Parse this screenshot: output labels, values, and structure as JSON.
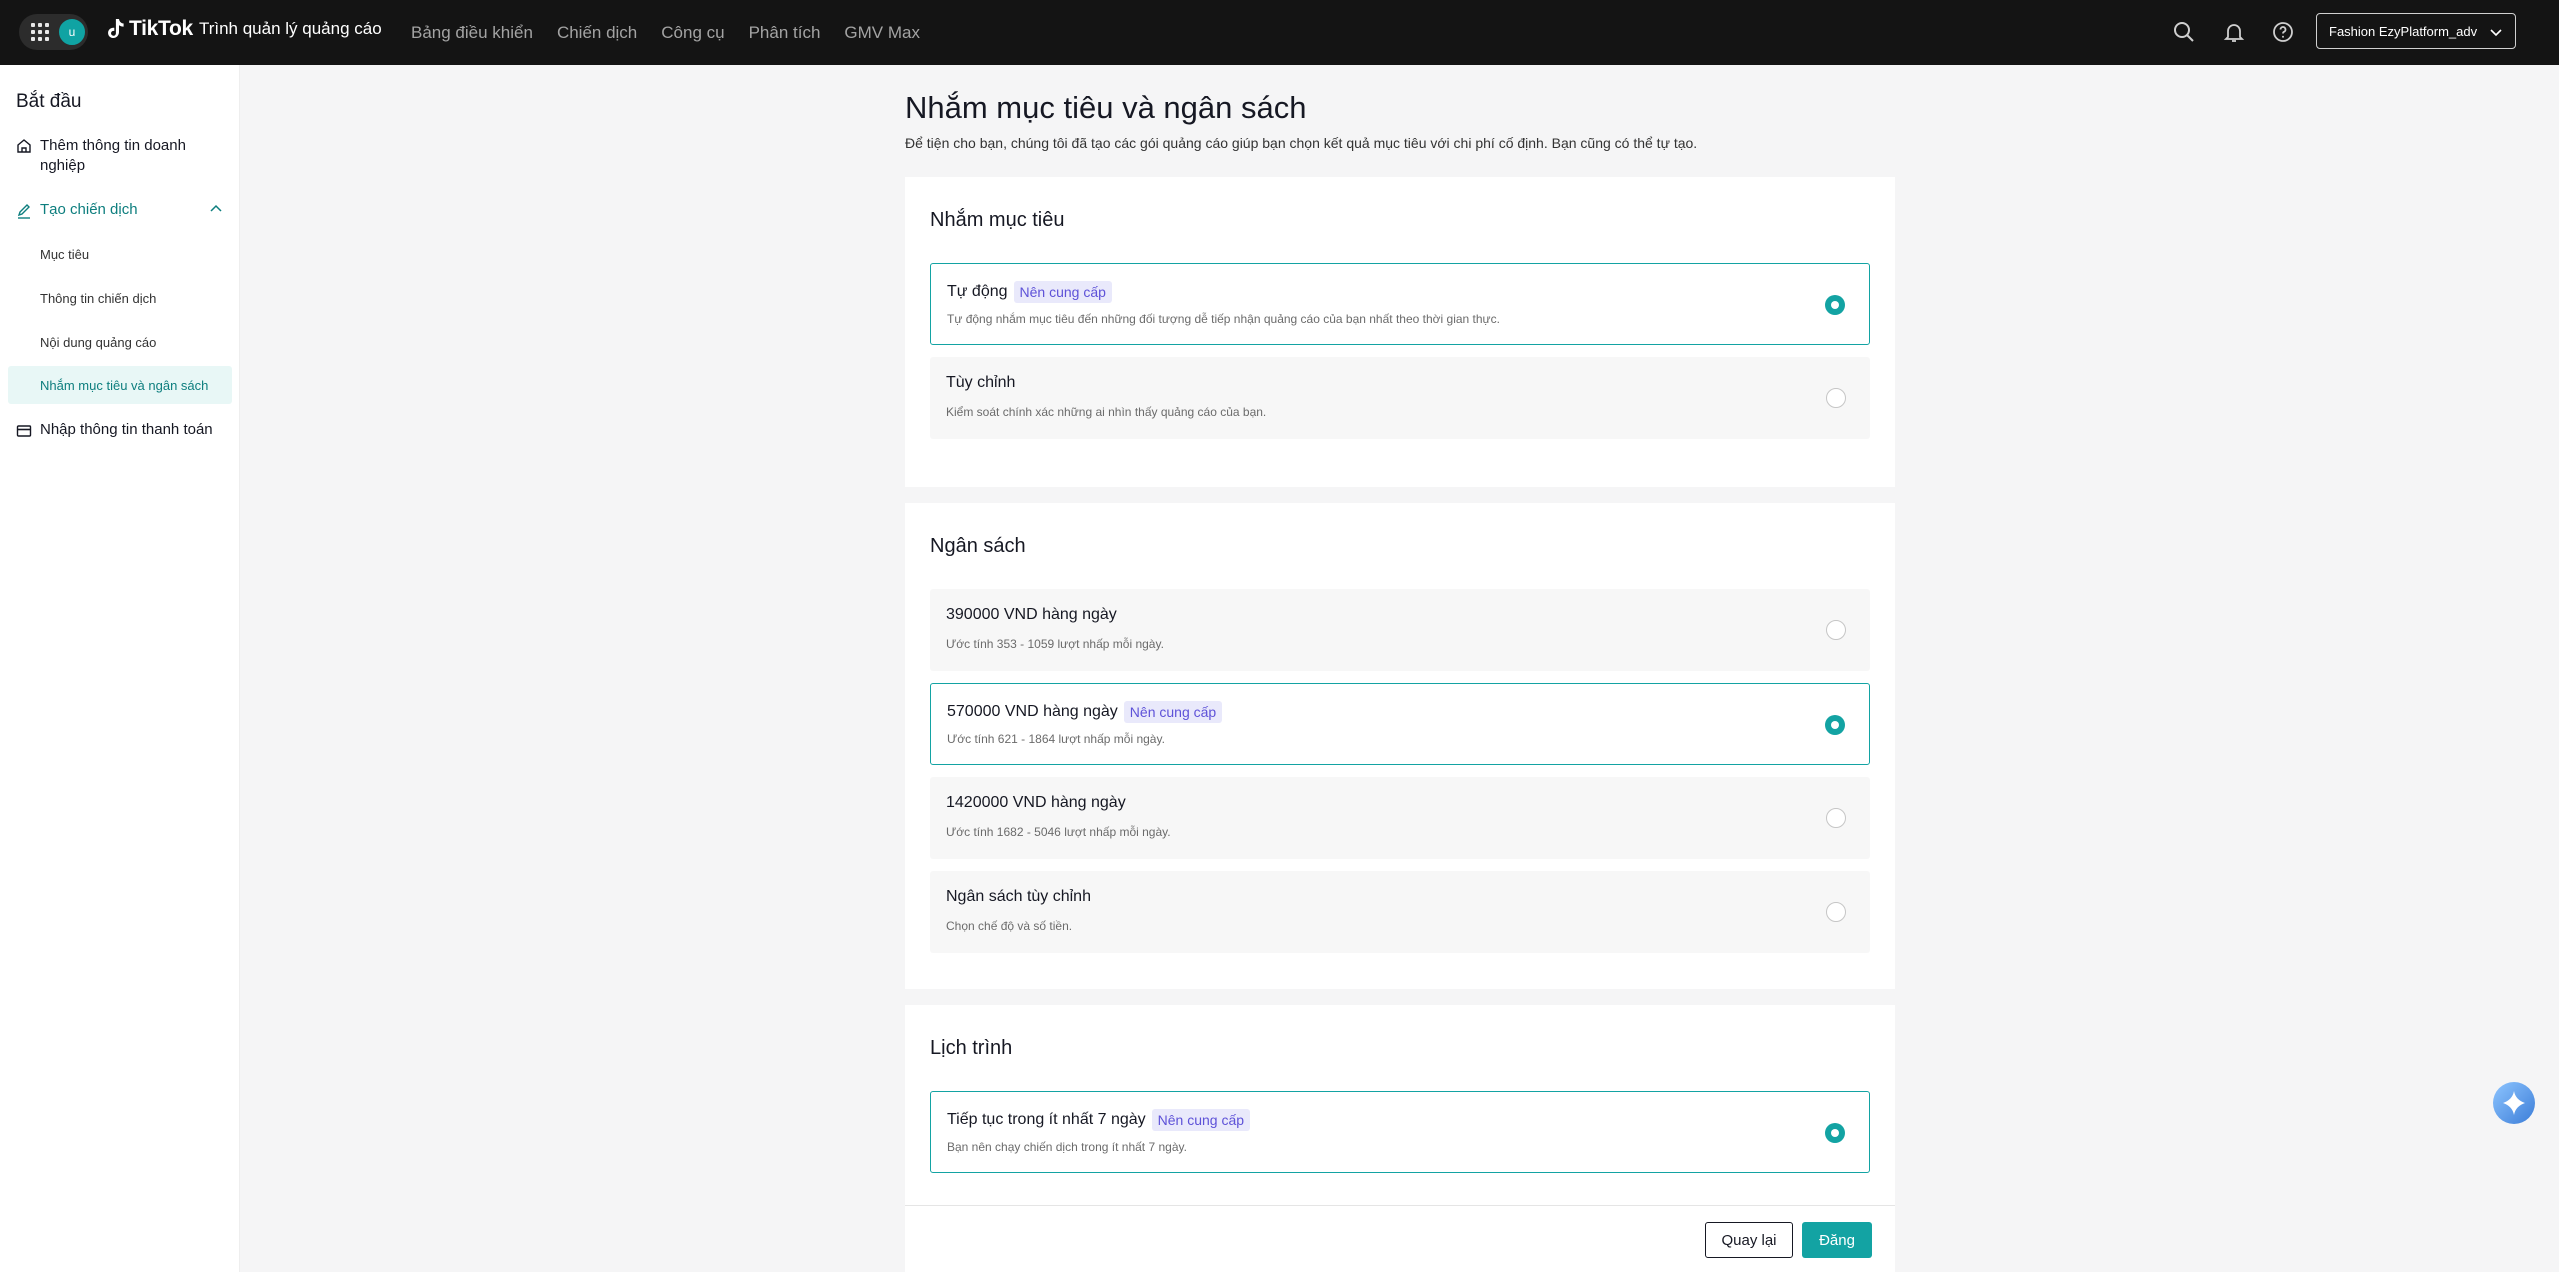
{
  "topbar": {
    "avatar_initial": "u",
    "logo_word": "TikTok",
    "logo_sub": "Trình quản lý quảng cáo",
    "nav": [
      "Bảng điều khiển",
      "Chiến dịch",
      "Công cụ",
      "Phân tích",
      "GMV Max"
    ],
    "account_name": "Fashion EzyPlatform_adv",
    "icons": [
      "search-icon",
      "bell-icon",
      "help-icon"
    ]
  },
  "sidebar": {
    "title": "Bắt đầu",
    "business_info": "Thêm thông tin doanh nghiệp",
    "create_campaign": "Tạo chiến dịch",
    "sub_items": [
      "Mục tiêu",
      "Thông tin chiến dịch",
      "Nội dung quảng cáo",
      "Nhắm mục tiêu và ngân sách"
    ],
    "payment": "Nhập thông tin thanh toán"
  },
  "page": {
    "title": "Nhắm mục tiêu và ngân sách",
    "description": "Để tiện cho bạn, chúng tôi đã tạo các gói quảng cáo giúp bạn chọn kết quả mục tiêu với chi phí cố định. Bạn cũng có thể tự tạo."
  },
  "targeting": {
    "title": "Nhắm mục tiêu",
    "options": [
      {
        "label": "Tự động",
        "badge": "Nên cung cấp",
        "desc": "Tự động nhắm mục tiêu đến những đối tượng dễ tiếp nhận quảng cáo của bạn nhất theo thời gian thực.",
        "selected": true
      },
      {
        "label": "Tùy chỉnh",
        "badge": "",
        "desc": "Kiểm soát chính xác những ai nhìn thấy quảng cáo của bạn.",
        "selected": false
      }
    ]
  },
  "budget": {
    "title": "Ngân sách",
    "options": [
      {
        "label": "390000 VND hàng ngày",
        "badge": "",
        "desc": "Ước tính 353 - 1059 lượt nhấp mỗi ngày.",
        "selected": false
      },
      {
        "label": "570000 VND hàng ngày",
        "badge": "Nên cung cấp",
        "desc": "Ước tính 621 - 1864 lượt nhấp mỗi ngày.",
        "selected": true
      },
      {
        "label": "1420000 VND hàng ngày",
        "badge": "",
        "desc": "Ước tính 1682 - 5046 lượt nhấp mỗi ngày.",
        "selected": false
      },
      {
        "label": "Ngân sách tùy chỉnh",
        "badge": "",
        "desc": "Chọn chế độ và số tiền.",
        "selected": false
      }
    ]
  },
  "schedule": {
    "title": "Lịch trình",
    "options": [
      {
        "label": "Tiếp tục trong ít nhất 7 ngày",
        "badge": "Nên cung cấp",
        "desc": "Bạn nên chạy chiến dịch trong ít nhất 7 ngày.",
        "selected": true
      }
    ]
  },
  "footer": {
    "back_label": "Quay lại",
    "post_label": "Đăng"
  },
  "colors": {
    "accent": "#13a3a3",
    "badge_bg": "#e9e9fb",
    "badge_text": "#5e52d8",
    "topbar": "#141414"
  }
}
